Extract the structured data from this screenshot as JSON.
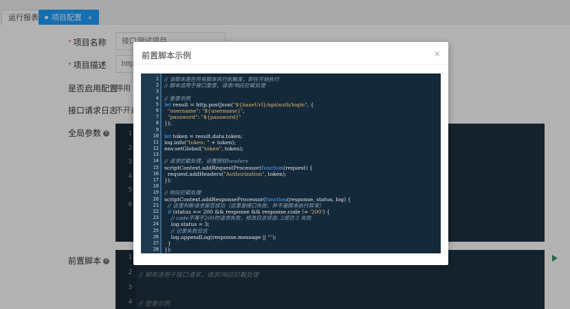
{
  "tabs": [
    {
      "label": "运行报表"
    },
    {
      "label": "项目配置",
      "close": "×"
    }
  ],
  "form": {
    "project_name": {
      "label": "项目名称",
      "value": "接口测试项目"
    },
    "project_desc": {
      "label": "项目描述",
      "value": "http"
    },
    "enable_config": {
      "label": "是否启用配置",
      "value": "停用"
    },
    "request_log": {
      "label": "接口请求日志",
      "value": "不开启"
    },
    "global_params": {
      "label": "全局参数",
      "help": "?"
    },
    "pre_script": {
      "label": "前置脚本",
      "help": "?"
    }
  },
  "bg_editor_top": {
    "line_numbers": [
      "1",
      "2",
      "3",
      "4",
      "5",
      "6"
    ]
  },
  "bg_editor_bottom": {
    "line_numbers": [
      "1",
      "2",
      "3",
      "4"
    ],
    "line2": "// 脚本适用于接口请求，请求/响应拦截处理",
    "line4": "// 登录示例"
  },
  "modal": {
    "title": "前置脚本示例",
    "close": "×",
    "code_lines": [
      "// 该脚本是在所有脚本执行前触发，即在开始执行",
      "// 脚本适用于接口登录，请求/响应拦截处理",
      "",
      "// 登录示例",
      "let result = http.postJson(\"${baseUrl}/api/auth/login\", {",
      "  \"username\": \"${username}\",",
      "  \"password\": \"${password}\"",
      "});",
      "",
      "let token = result.data.token;",
      "log.info(\"token: \" + token);",
      "env.setGlobal(\"token\", token);",
      "",
      "// 请求拦截处理，设置授权headers",
      "scriptContext.addRequestProcessor(function(request) {",
      "  request.addHeaders(\"Authorization\", token);",
      "});",
      "",
      "// 响应拦截处理",
      "scriptContext.addResponseProcessor(function(response, status, log) {",
      "  // 这里判断请求是否成功（这里是接口失败，并不是脚本执行异常）",
      "  if (status == 200 && response && response.code != '200') {",
      "    // code不等于200时请求失败，修改日志状态: 2成功 3 失败",
      "    log.status = 3;",
      "    // 记录失败日志",
      "    log.appendLog(response.message || \"\");",
      "  }",
      "});"
    ]
  },
  "colors": {
    "accent": "#1e9fff",
    "editor_bg": "#14293a",
    "comment": "#8fa6b8",
    "string": "#e6b86a",
    "keyword": "#4fa8ff"
  }
}
